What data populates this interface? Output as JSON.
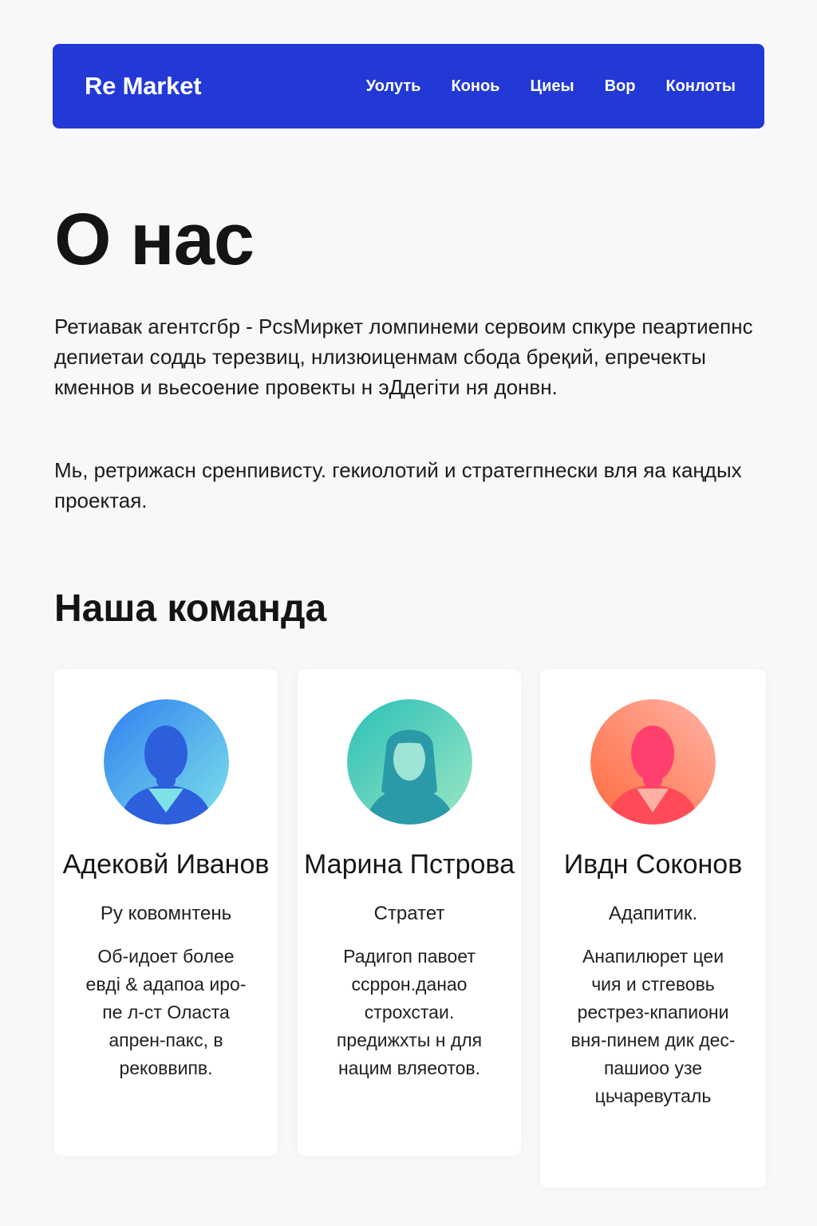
{
  "nav": {
    "brand": "Re Market",
    "links": [
      "Уолуть",
      "Коноь",
      "Циеы",
      "Вор",
      "Конлоты"
    ]
  },
  "about": {
    "title": "О нас",
    "paragraphs": [
      "Ретиавак агентсгбр - РсѕМиркет ломпинеми сервоим спкуре пеартиепнс депиетаи соддь терезвиц, нлизюиценмам сбода бреқий, епречекты кменнов и вьесоение провекты н эДдегіти ня донвн.",
      "Мь, ретрижасн сренпивисту. гекиолотий и стратегпнески вля яа каңдых проектая."
    ]
  },
  "team": {
    "title": "Наша команда",
    "members": [
      {
        "name": "Адековй Иванов",
        "role": "Ру ковомнтень",
        "bio": "Об-идоет более евді & адапоа иро-пе л-ст Оласта апрен-пакс, в рековвипв.",
        "avatar_colors": [
          "#2f7ff0",
          "#7fe2ea",
          "#2d5fdc"
        ]
      },
      {
        "name": "Марина Пстрова",
        "role": "Стратет",
        "bio": "Радигоп павоет ссррон.данао строхстаи. предижхты н для нацим вляеотов.",
        "avatar_colors": [
          "#2bbfb7",
          "#9be7c4",
          "#3a9fae"
        ]
      },
      {
        "name": "Ивдн Соконов",
        "role": "Адапитик.",
        "bio": "Анапилюрет цеи чия и стгевовь рестрез-кпапиони вня-пинем дик дес-пашиоо узе цьчаревуталь",
        "avatar_colors": [
          "#ff6a3d",
          "#ffb3a6",
          "#ff3f6d"
        ]
      }
    ]
  }
}
